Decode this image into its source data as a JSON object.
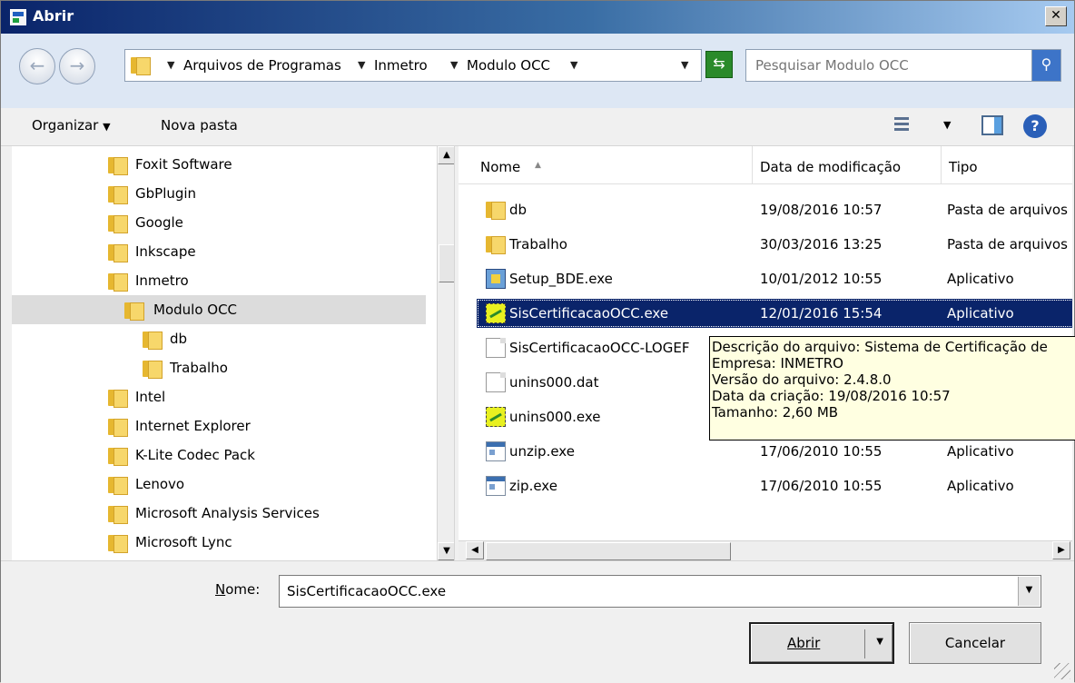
{
  "window": {
    "title": "Abrir"
  },
  "address": {
    "crumbs": [
      "Arquivos de Programas",
      "Inmetro",
      "Modulo OCC"
    ],
    "search_placeholder": "Pesquisar Modulo OCC"
  },
  "toolbar": {
    "organize_label": "Organizar",
    "new_folder_label": "Nova pasta"
  },
  "tree": {
    "items": [
      {
        "label": "Foxit Software",
        "icon": "folder-icon"
      },
      {
        "label": "GbPlugin",
        "icon": "locked-folder-icon"
      },
      {
        "label": "Google",
        "icon": "folder-icon"
      },
      {
        "label": "Inkscape",
        "icon": "folder-icon"
      },
      {
        "label": "Inmetro",
        "icon": "folder-icon"
      },
      {
        "label": "Modulo OCC",
        "icon": "folder-icon",
        "selected": true
      },
      {
        "label": "db",
        "icon": "folder-icon"
      },
      {
        "label": "Trabalho",
        "icon": "folder-icon"
      },
      {
        "label": "Intel",
        "icon": "folder-icon"
      },
      {
        "label": "Internet Explorer",
        "icon": "folder-icon"
      },
      {
        "label": "K-Lite Codec Pack",
        "icon": "folder-icon"
      },
      {
        "label": "Lenovo",
        "icon": "folder-icon"
      },
      {
        "label": "Microsoft Analysis Services",
        "icon": "folder-icon"
      },
      {
        "label": "Microsoft Lync",
        "icon": "folder-icon"
      }
    ]
  },
  "files": {
    "columns": {
      "name": "Nome",
      "date": "Data de modificação",
      "type": "Tipo"
    },
    "rows": [
      {
        "name": "db",
        "date": "19/08/2016 10:57",
        "type": "Pasta de arquivos",
        "icon": "folder-icon"
      },
      {
        "name": "Trabalho",
        "date": "30/03/2016 13:25",
        "type": "Pasta de arquivos",
        "icon": "folder-icon"
      },
      {
        "name": "Setup_BDE.exe",
        "date": "10/01/2012 10:55",
        "type": "Aplicativo",
        "icon": "setup-icon"
      },
      {
        "name": "SisCertificacaoOCC.exe",
        "date": "12/01/2016 15:54",
        "type": "Aplicativo",
        "icon": "occ-app-icon",
        "selected": true
      },
      {
        "name": "SisCertificacaoOCC-LOGEF",
        "date": "",
        "type": "",
        "icon": "document-icon"
      },
      {
        "name": "unins000.dat",
        "date": "",
        "type": "",
        "icon": "document-icon"
      },
      {
        "name": "unins000.exe",
        "date": "",
        "type": "",
        "icon": "occ-app-icon"
      },
      {
        "name": "unzip.exe",
        "date": "17/06/2010 10:55",
        "type": "Aplicativo",
        "icon": "exe-icon"
      },
      {
        "name": "zip.exe",
        "date": "17/06/2010 10:55",
        "type": "Aplicativo",
        "icon": "exe-icon"
      }
    ]
  },
  "tooltip": {
    "lines": [
      "Descrição do arquivo: Sistema de Certificação de",
      "Empresa: INMETRO",
      "Versão do arquivo: 2.4.8.0",
      "Data da criação: 19/08/2016 10:57",
      "Tamanho: 2,60 MB"
    ]
  },
  "footer": {
    "name_label_underlined": "N",
    "name_label_rest": "ome:",
    "name_value": "SisCertificacaoOCC.exe",
    "open_label": "Abrir",
    "cancel_label": "Cancelar"
  }
}
